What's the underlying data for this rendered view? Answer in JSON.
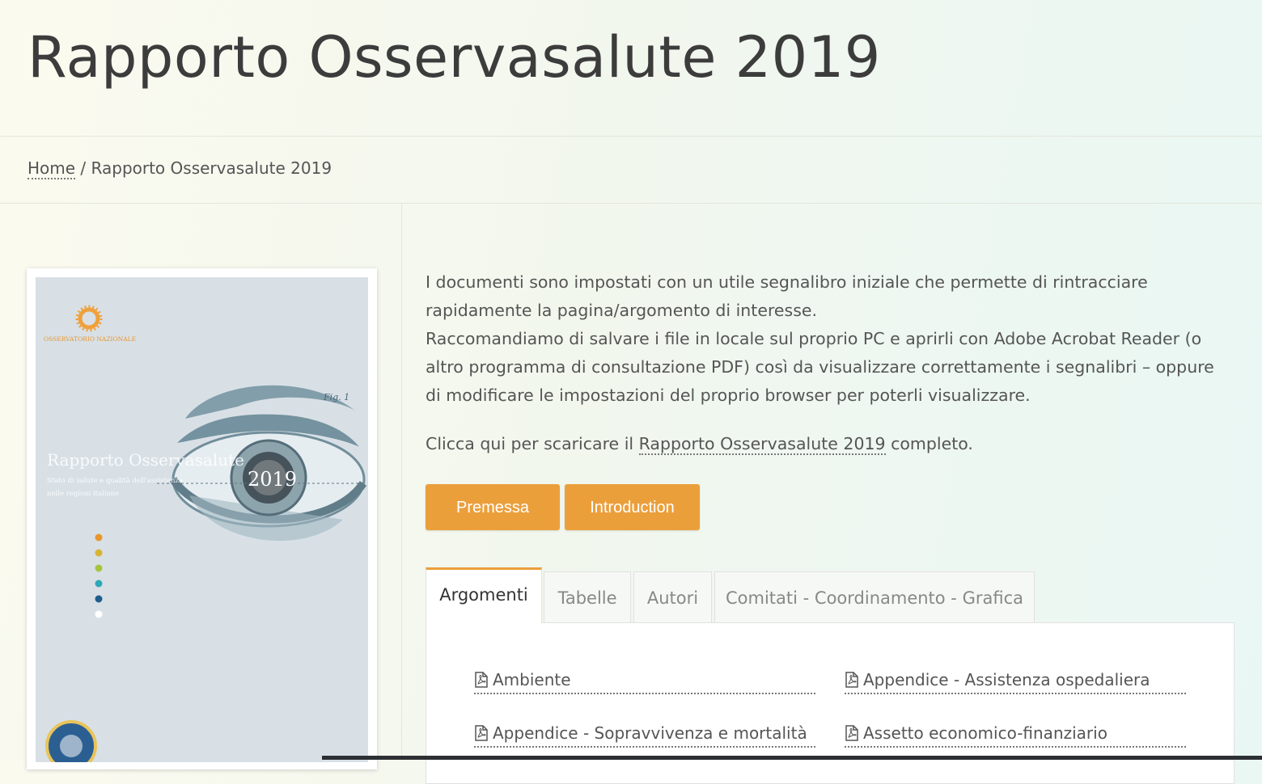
{
  "page": {
    "title": "Rapporto Osservasalute 2019"
  },
  "breadcrumb": {
    "home": "Home",
    "separator": "/",
    "current": "Rapporto Osservasalute 2019"
  },
  "cover": {
    "logo_text": "OSSERVATORIO NAZIONALE",
    "title": "Rapporto Osservasalute",
    "subtitle_line1": "Stato di salute e qualità dell'assistenza",
    "subtitle_line2": "nelle regioni italiane",
    "year": "2019",
    "fig_label": "Fig. 1",
    "dot_colors": [
      "#e8962e",
      "#d7b533",
      "#a9c23f",
      "#2fa7b8",
      "#1d5e8c",
      "#ffffff"
    ],
    "accent_color": "#f0a03c"
  },
  "intro": {
    "line1": "I documenti sono impostati con un utile segnalibro iniziale che permette di rintracciare",
    "line2": "rapidamente la pagina/argomento di interesse.",
    "line3": "Raccomandiamo di salvare i file in locale sul proprio PC e aprirli con Adobe Acrobat Reader (o",
    "line4": "altro programma di consultazione PDF) così da visualizzare correttamente i segnalibri – oppure",
    "line5": "di modificare le impostazioni del proprio browser per poterli visualizzare."
  },
  "download": {
    "prefix": "Clicca qui per scaricare il",
    "link": "Rapporto Osservasalute 2019",
    "suffix": "completo."
  },
  "buttons": {
    "premessa": "Premessa",
    "introduction": "Introduction",
    "color": "#eb9f3b"
  },
  "tabs": [
    {
      "label": "Argomenti",
      "active": true
    },
    {
      "label": "Tabelle",
      "active": false
    },
    {
      "label": "Autori",
      "active": false
    },
    {
      "label": "Comitati - Coordinamento - Grafica",
      "active": false
    }
  ],
  "documents": [
    {
      "label": "Ambiente",
      "icon": "pdf-icon"
    },
    {
      "label": "Appendice - Assistenza ospedaliera",
      "icon": "pdf-icon"
    },
    {
      "label": "Appendice - Sopravvivenza e mortalità",
      "icon": "pdf-icon"
    },
    {
      "label": "Assetto economico-finanziario",
      "icon": "pdf-icon"
    }
  ]
}
